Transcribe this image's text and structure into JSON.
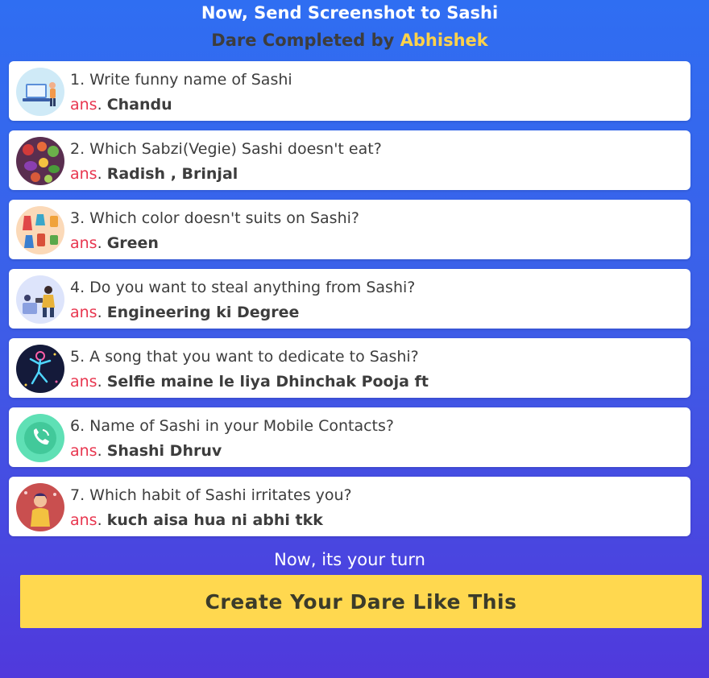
{
  "header": {
    "title": "Now, Send Screenshot to Sashi",
    "completed_prefix": "Dare Completed by",
    "completed_name": "Abhishek"
  },
  "answer_label": "ans",
  "items": [
    {
      "question": "1. Write funny name of Sashi",
      "answer": "Chandu",
      "icon": "laptop-person-icon"
    },
    {
      "question": "2. Which Sabzi(Vegie) Sashi doesn't eat?",
      "answer": "Radish , Brinjal",
      "icon": "vegetables-icon"
    },
    {
      "question": "3. Which color doesn't suits on Sashi?",
      "answer": "Green",
      "icon": "clothes-icon"
    },
    {
      "question": "4. Do you want to steal anything from Sashi?",
      "answer": "Engineering ki Degree",
      "icon": "thief-icon"
    },
    {
      "question": "5. A song that you want to dedicate to Sashi?",
      "answer": "Selfie maine le liya Dhinchak Pooja ft",
      "icon": "dancer-icon"
    },
    {
      "question": "6. Name of Sashi in your Mobile Contacts?",
      "answer": "Shashi Dhruv",
      "icon": "phone-icon"
    },
    {
      "question": "7. Which habit of Sashi irritates you?",
      "answer": "kuch aisa hua ni abhi tkk",
      "icon": "irritated-person-icon"
    }
  ],
  "footer": {
    "turn_text": "Now, its your turn",
    "cta_label": "Create Your Dare Like This"
  },
  "colors": {
    "accent_name": "#ffd24a",
    "answer_label": "#e8364f",
    "cta_bg": "#ffd84f"
  }
}
